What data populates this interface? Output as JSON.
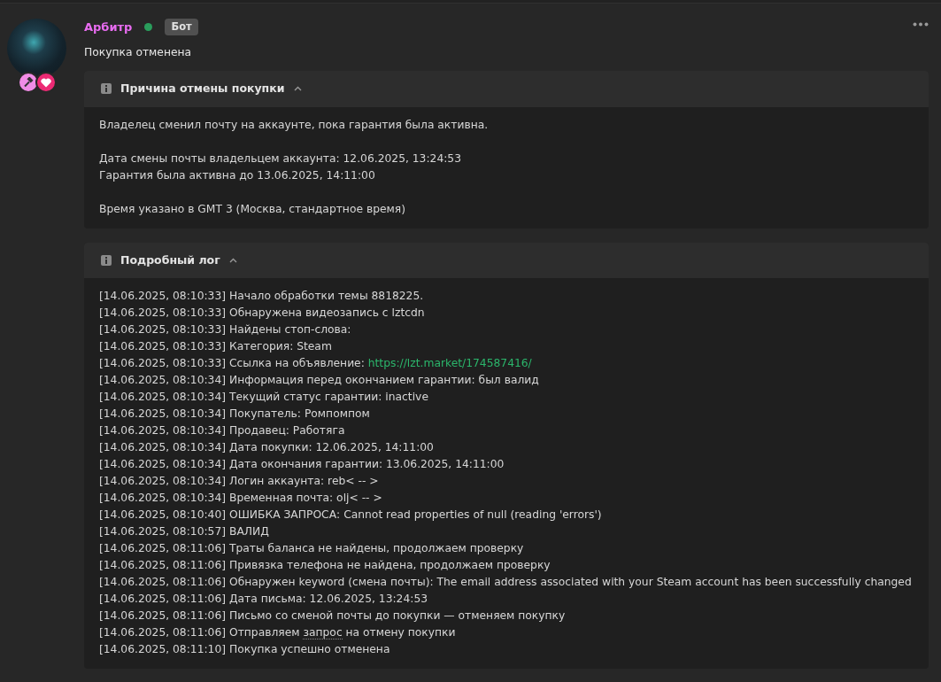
{
  "author": {
    "name": "Арбитр",
    "online": true,
    "role_badge": "Бот"
  },
  "message": "Покупка отменена",
  "panels": [
    {
      "title": "Причина отмены покупки",
      "expanded": true,
      "kind": "paragraphs",
      "paragraphs": [
        [
          "Владелец сменил почту на аккаунте, пока гарантия была активна."
        ],
        [
          "Дата смены почты владельцем аккаунта: 12.06.2025, 13:24:53",
          "Гарантия была активна до 13.06.2025, 14:11:00"
        ],
        [
          "Время указано в GMT 3 (Москва, стандартное время)"
        ]
      ]
    },
    {
      "title": "Подробный лог",
      "expanded": true,
      "kind": "log",
      "lines": [
        [
          {
            "kind": "text",
            "text": "[14.06.2025, 08:10:33] Начало обработки темы 8818225."
          }
        ],
        [
          {
            "kind": "text",
            "text": "[14.06.2025, 08:10:33] Обнаружена видеозапись с lztcdn"
          }
        ],
        [
          {
            "kind": "text",
            "text": "[14.06.2025, 08:10:33] Найдены стоп-слова:"
          }
        ],
        [
          {
            "kind": "text",
            "text": "[14.06.2025, 08:10:33] Категория: Steam"
          }
        ],
        [
          {
            "kind": "text",
            "text": "[14.06.2025, 08:10:33] Ссылка на объявление: "
          },
          {
            "kind": "link",
            "text": "https://lzt.market/174587416/"
          }
        ],
        [
          {
            "kind": "text",
            "text": "[14.06.2025, 08:10:34] Информация перед окончанием гарантии: был валид"
          }
        ],
        [
          {
            "kind": "text",
            "text": "[14.06.2025, 08:10:34] Текущий статус гарантии: inactive"
          }
        ],
        [
          {
            "kind": "text",
            "text": "[14.06.2025, 08:10:34] Покупатель: Ромпомпом"
          }
        ],
        [
          {
            "kind": "text",
            "text": "[14.06.2025, 08:10:34] Продавец: Работяга"
          }
        ],
        [
          {
            "kind": "text",
            "text": "[14.06.2025, 08:10:34] Дата покупки: 12.06.2025, 14:11:00"
          }
        ],
        [
          {
            "kind": "text",
            "text": "[14.06.2025, 08:10:34] Дата окончания гарантии: 13.06.2025, 14:11:00"
          }
        ],
        [
          {
            "kind": "text",
            "text": "[14.06.2025, 08:10:34] Логин аккаунта: reb< -- >"
          }
        ],
        [
          {
            "kind": "text",
            "text": "[14.06.2025, 08:10:34] Временная почта: olj< -- >"
          }
        ],
        [
          {
            "kind": "text",
            "text": "[14.06.2025, 08:10:40] ОШИБКА ЗАПРОСА: Cannot read properties of null (reading 'errors')"
          }
        ],
        [
          {
            "kind": "text",
            "text": "[14.06.2025, 08:10:57] ВАЛИД"
          }
        ],
        [
          {
            "kind": "text",
            "text": "[14.06.2025, 08:11:06] Траты баланса не найдены, продолжаем проверку"
          }
        ],
        [
          {
            "kind": "text",
            "text": "[14.06.2025, 08:11:06] Привязка телефона не найдена, продолжаем проверку"
          }
        ],
        [
          {
            "kind": "text",
            "text": "[14.06.2025, 08:11:06] Обнаружен keyword (смена почты): The email address associated with your Steam account has been successfully changed"
          }
        ],
        [
          {
            "kind": "text",
            "text": "[14.06.2025, 08:11:06] Дата письма: 12.06.2025, 13:24:53"
          }
        ],
        [
          {
            "kind": "text",
            "text": "[14.06.2025, 08:11:06] Письмо со сменой почты до покупки — отменяем покупку"
          }
        ],
        [
          {
            "kind": "text",
            "text": "[14.06.2025, 08:11:06] Отправляем "
          },
          {
            "kind": "term",
            "text": "запрос"
          },
          {
            "kind": "text",
            "text": " на отмену покупки"
          }
        ],
        [
          {
            "kind": "text",
            "text": "[14.06.2025, 08:11:10] Покупка успешно отменена"
          }
        ]
      ]
    }
  ]
}
